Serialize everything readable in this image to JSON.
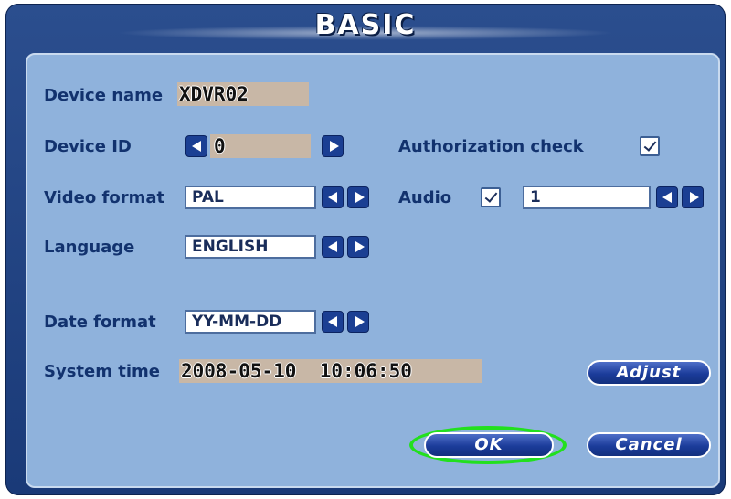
{
  "dialog": {
    "title": "BASIC"
  },
  "labels": {
    "device_name": "Device name",
    "device_id": "Device ID",
    "authorization_check": "Authorization check",
    "video_format": "Video format",
    "audio": "Audio",
    "language": "Language",
    "date_format": "Date format",
    "system_time": "System time"
  },
  "values": {
    "device_name": "XDVR02",
    "device_id": "0",
    "authorization_checked": true,
    "video_format": "PAL",
    "audio_checked": true,
    "audio_channel": "1",
    "language": "ENGLISH",
    "date_format": "YY-MM-DD",
    "system_time": "2008-05-10  10:06:50"
  },
  "buttons": {
    "adjust": "Adjust",
    "ok": "OK",
    "cancel": "Cancel"
  },
  "colors": {
    "panel": "#8fb2dc",
    "frame": "#1a3a78",
    "label": "#12326e",
    "highlight": "#22e01e"
  }
}
